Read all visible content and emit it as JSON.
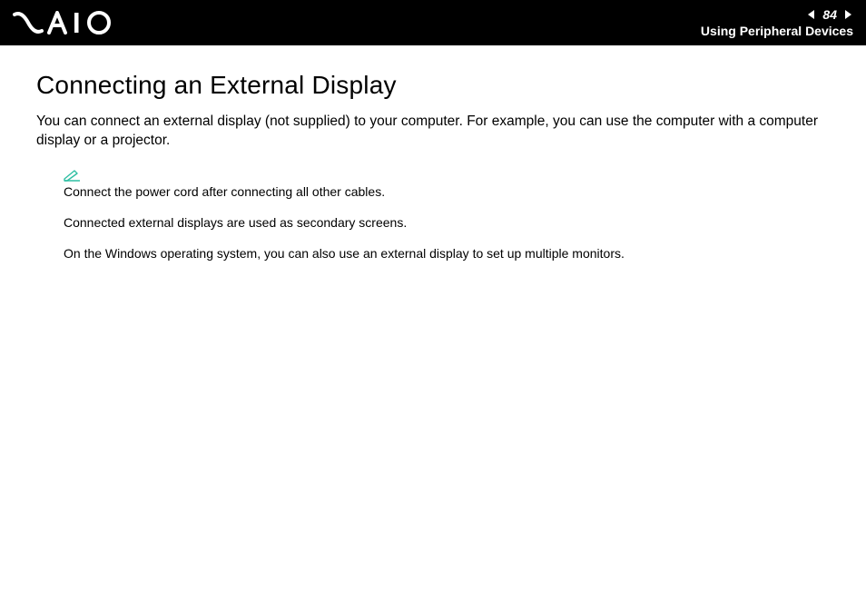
{
  "header": {
    "page_number": "84",
    "section": "Using Peripheral Devices"
  },
  "content": {
    "title": "Connecting an External Display",
    "intro": "You can connect an external display (not supplied) to your computer. For example, you can use the computer with a computer display or a projector.",
    "notes": {
      "line1": "Connect the power cord after connecting all other cables.",
      "line2": "Connected external displays are used as secondary screens.",
      "line3": "On the Windows operating system, you can also use an external display to set up multiple monitors."
    }
  }
}
